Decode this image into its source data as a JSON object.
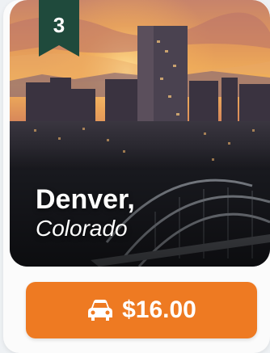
{
  "card": {
    "rank": "3",
    "city": "Denver,",
    "state": "Colorado",
    "price": "$16.00",
    "price_icon": "car-icon",
    "colors": {
      "ribbon": "#1f4a3c",
      "button": "#ee7a22",
      "text": "#ffffff"
    }
  }
}
